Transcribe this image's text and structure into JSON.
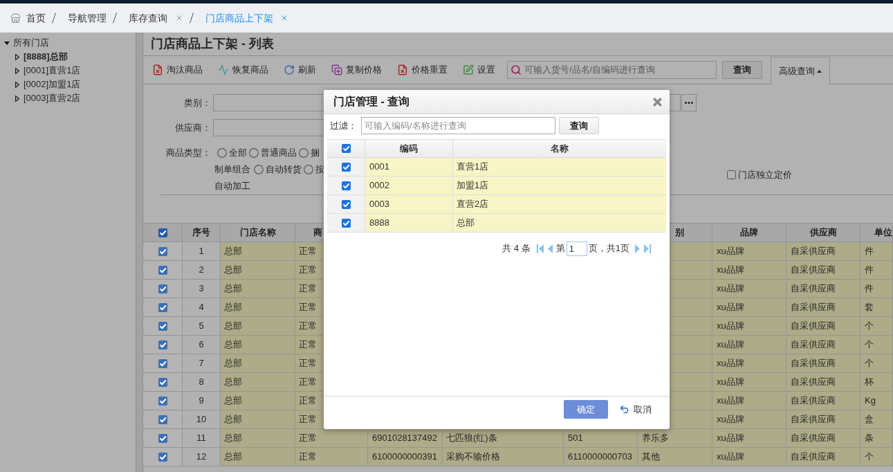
{
  "breadcrumb": [
    {
      "label": "首页",
      "kind": "home",
      "closable": false,
      "selected": false
    },
    {
      "label": "导航管理",
      "kind": "link",
      "closable": false,
      "selected": false
    },
    {
      "label": "库存查询",
      "kind": "link",
      "closable": true,
      "selected": false
    },
    {
      "label": "门店商品上下架",
      "kind": "link",
      "closable": true,
      "selected": true
    }
  ],
  "store_tree": {
    "label": "所有门店",
    "expanded": true,
    "children": [
      {
        "label": "[8888]总部",
        "selected": true,
        "expanded": false
      },
      {
        "label": "[0001]直营1店",
        "selected": false,
        "expanded": false
      },
      {
        "label": "[0002]加盟1店",
        "selected": false,
        "expanded": false
      },
      {
        "label": "[0003]直营2店",
        "selected": false,
        "expanded": false
      }
    ]
  },
  "page_title": "门店商品上下架 - 列表",
  "toolbar": {
    "buttons": [
      {
        "label": "淘汰商品"
      },
      {
        "label": "恢复商品"
      },
      {
        "label": "刷新"
      },
      {
        "label": "复制价格"
      },
      {
        "label": "价格重置"
      },
      {
        "label": "设置"
      }
    ],
    "search_placeholder": "可输入货号/品名/自编码进行查询",
    "search_button": "查询",
    "advanced_search": {
      "label": "高级查询",
      "expanded": true
    }
  },
  "filters": {
    "category_label": "类别：",
    "supplier_label": "供应商：",
    "product_type": {
      "label": "商品类型：",
      "lines": [
        [
          {
            "kind": "radio",
            "label": "全部",
            "selected": false
          },
          {
            "kind": "radio",
            "label": "普通商品",
            "selected": false
          },
          {
            "kind": "radio",
            "label": "捆",
            "selected": false
          }
        ],
        [
          {
            "kind": "text",
            "label": "制单组合"
          },
          {
            "kind": "radio",
            "label": "自动转货",
            "selected": false
          },
          {
            "kind": "radio",
            "label": "按",
            "selected": false
          }
        ],
        [
          {
            "kind": "text",
            "label": "自动加工"
          }
        ]
      ]
    },
    "store_pricing": {
      "label": "门店独立定价",
      "checked": false
    }
  },
  "table": {
    "all_checked": true,
    "columns": {
      "seq": "序号",
      "store": "门店名称",
      "column_4": "商",
      "column_8": "别",
      "brand": "品牌",
      "supplier": "供应商",
      "unit": "单位"
    },
    "rows": [
      {
        "checked": true,
        "seq": "1",
        "store": "总部",
        "column_4": "正常",
        "brand": "xu品牌",
        "supplier": "自采供应商",
        "unit": "件"
      },
      {
        "checked": true,
        "seq": "2",
        "store": "总部",
        "column_4": "正常",
        "brand": "xu品牌",
        "supplier": "自采供应商",
        "unit": "件"
      },
      {
        "checked": true,
        "seq": "3",
        "store": "总部",
        "column_4": "正常",
        "brand": "xu品牌",
        "supplier": "自采供应商",
        "unit": "件"
      },
      {
        "checked": true,
        "seq": "4",
        "store": "总部",
        "column_4": "正常",
        "brand": "xu品牌",
        "supplier": "自采供应商",
        "unit": "套"
      },
      {
        "checked": true,
        "seq": "5",
        "store": "总部",
        "column_4": "正常",
        "brand": "xu品牌",
        "supplier": "自采供应商",
        "unit": "个"
      },
      {
        "checked": true,
        "seq": "6",
        "store": "总部",
        "column_4": "正常",
        "brand": "xu品牌",
        "supplier": "自采供应商",
        "unit": "个"
      },
      {
        "checked": true,
        "seq": "7",
        "store": "总部",
        "column_4": "正常",
        "brand": "xu品牌",
        "supplier": "自采供应商",
        "unit": "个"
      },
      {
        "checked": true,
        "seq": "8",
        "store": "总部",
        "column_4": "正常",
        "brand": "xu品牌",
        "supplier": "自采供应商",
        "unit": "杯"
      },
      {
        "checked": true,
        "seq": "9",
        "store": "总部",
        "column_4": "正常",
        "brand": "xu品牌",
        "supplier": "自采供应商",
        "unit": "Kg"
      },
      {
        "checked": true,
        "seq": "10",
        "store": "总部",
        "column_4": "正常",
        "brand": "xu品牌",
        "supplier": "自采供应商",
        "unit": "盒"
      },
      {
        "checked": true,
        "seq": "11",
        "store": "总部",
        "column_4": "正常",
        "column_5": "6901028137492",
        "column_6": "七匹狼(红)条",
        "column_7": "501",
        "column_8": "养乐多",
        "brand": "xu品牌",
        "supplier": "自采供应商",
        "unit": "条"
      },
      {
        "checked": true,
        "seq": "12",
        "store": "总部",
        "column_4": "正常",
        "column_5": "6100000000391",
        "column_6": "采购不输价格",
        "column_7": "6110000000703",
        "column_8": "其他",
        "brand": "xu品牌",
        "supplier": "自采供应商",
        "unit": "个"
      }
    ]
  },
  "dialog": {
    "title": "门店管理 - 查询",
    "filter_label": "过滤：",
    "filter_placeholder": "可输入编码/名称进行查询",
    "filter_button": "查询",
    "all_checked": true,
    "columns": {
      "code": "编码",
      "name": "名称"
    },
    "rows": [
      {
        "checked": true,
        "code": "0001",
        "name": "直营1店"
      },
      {
        "checked": true,
        "code": "0002",
        "name": "加盟1店"
      },
      {
        "checked": true,
        "code": "0003",
        "name": "直营2店"
      },
      {
        "checked": true,
        "code": "8888",
        "name": "总部"
      }
    ],
    "pager": {
      "total": "共 4 条",
      "page_label": "第",
      "page": "1",
      "pages": "页，共1页"
    },
    "ok_button": "确定",
    "cancel_button": "取消"
  }
}
